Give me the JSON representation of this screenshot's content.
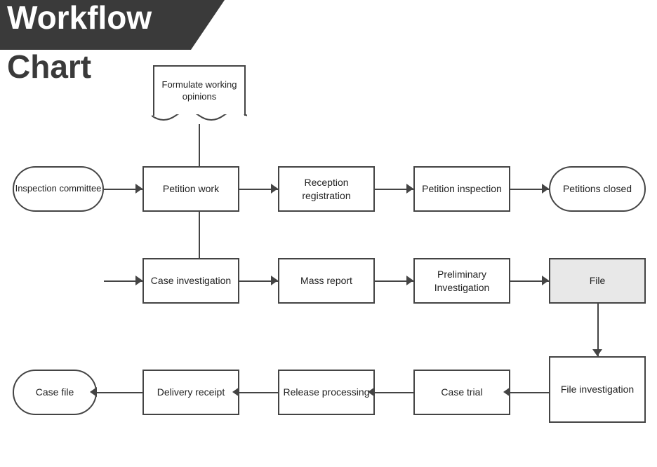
{
  "title": {
    "line1": "Workflow",
    "line2": "Chart"
  },
  "nodes": {
    "formulate": "Formulate working opinions",
    "inspection_committee": "Inspection committee",
    "petition_work": "Petition work",
    "reception_registration": "Reception registration",
    "petition_inspection": "Petition inspection",
    "petitions_closed": "Petitions closed",
    "case_investigation": "Case investigation",
    "mass_report": "Mass report",
    "preliminary_investigation": "Preliminary Investigation",
    "file": "File",
    "file_investigation": "File investigation",
    "case_trial": "Case trial",
    "release_processing": "Release processing",
    "delivery_receipt": "Delivery receipt",
    "case_file": "Case file"
  }
}
